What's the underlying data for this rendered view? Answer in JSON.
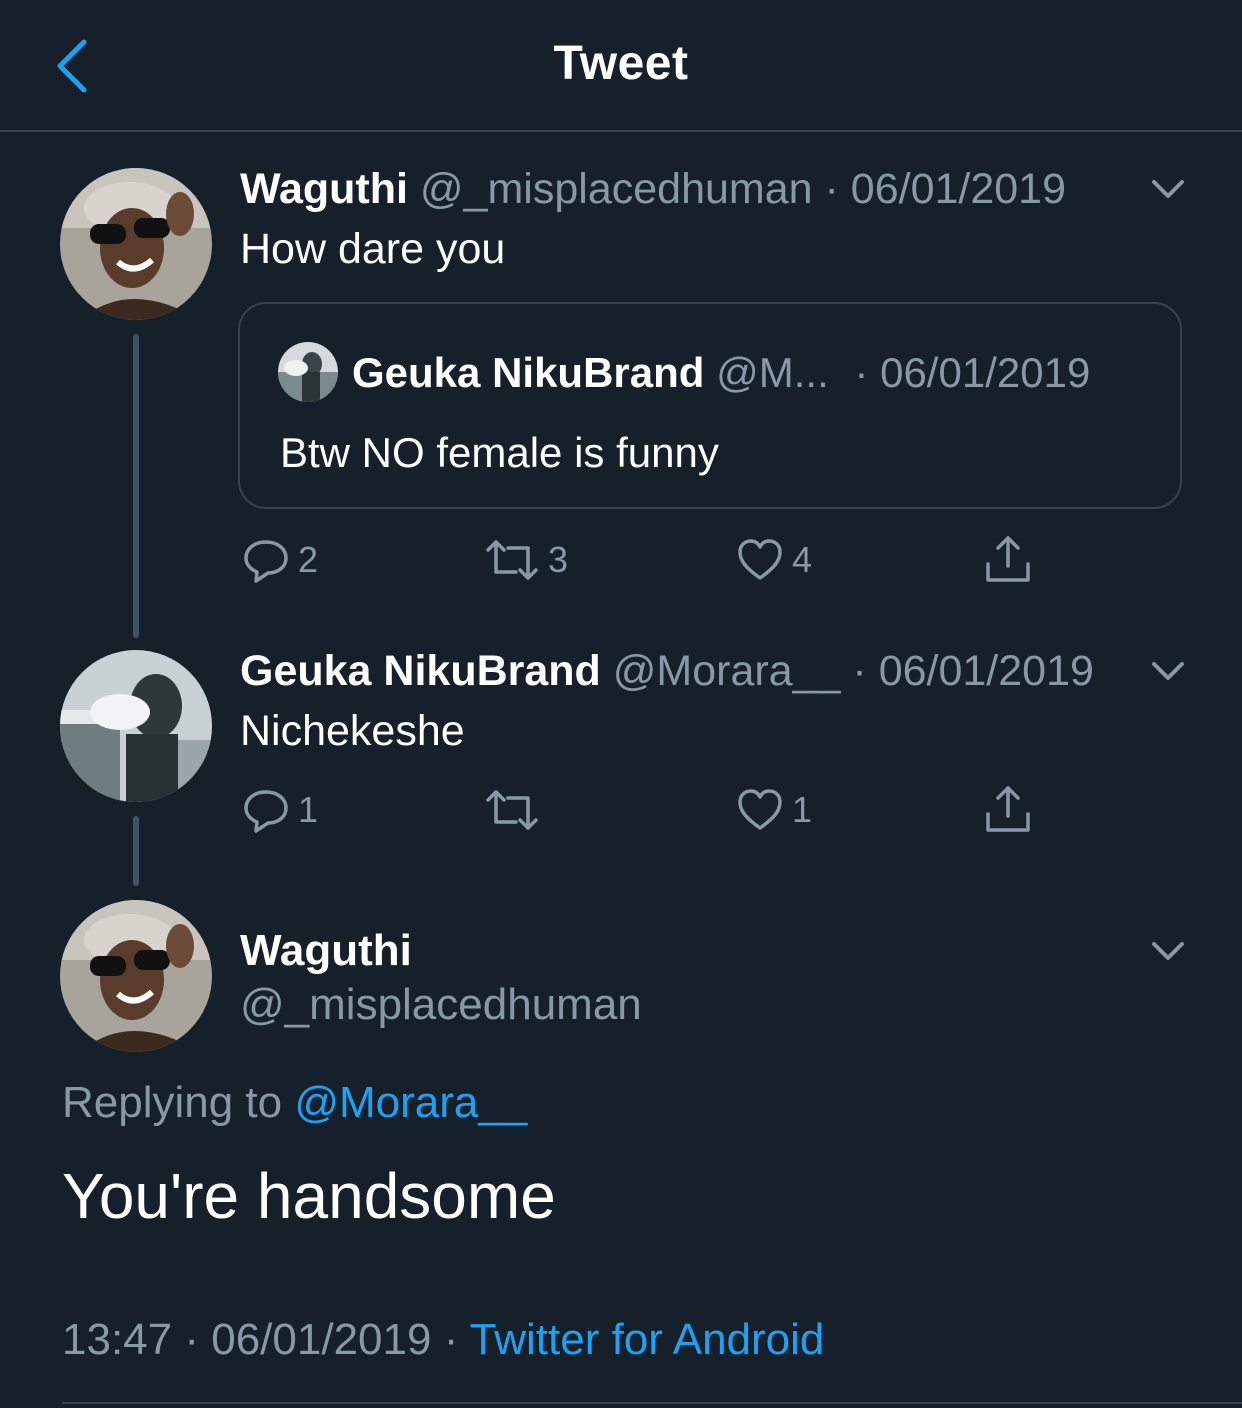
{
  "header": {
    "title": "Tweet",
    "back_icon": "chevron-left-icon"
  },
  "colors": {
    "background": "#15202b",
    "accent": "#1da1f2",
    "muted": "#8899a6",
    "divider": "#38444d"
  },
  "tweet1": {
    "name": "Waguthi",
    "handle": "@_misplacedhuman",
    "sep": "·",
    "date": "06/01/2019",
    "text": "How dare you",
    "quote": {
      "name": "Geuka NikuBrand",
      "handle": "@M...",
      "sep": "·",
      "date": "06/01/2019",
      "text": "Btw NO female is funny"
    },
    "actions": {
      "replies": "2",
      "retweets": "3",
      "likes": "4"
    }
  },
  "tweet2": {
    "name": "Geuka NikuBrand",
    "handle": "@Morara__",
    "sep": "·",
    "date": "06/01/2019",
    "text": "Nichekeshe",
    "actions": {
      "replies": "1",
      "retweets": "",
      "likes": "1"
    }
  },
  "main_tweet": {
    "name": "Waguthi",
    "handle": "@_misplacedhuman",
    "replying_prefix": "Replying to ",
    "replying_to": "@Morara__",
    "text": "You're handsome",
    "time": "13:47",
    "sep1": "·",
    "date": "06/01/2019",
    "sep2": "·",
    "source": "Twitter for Android"
  }
}
